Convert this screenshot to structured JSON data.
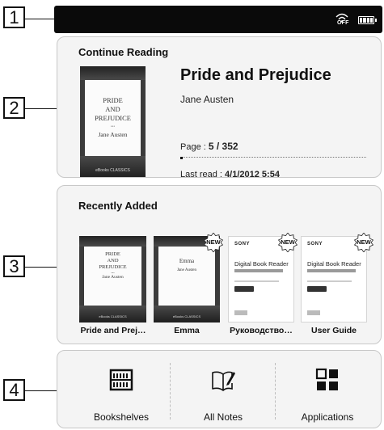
{
  "callouts": [
    "1",
    "2",
    "3",
    "4"
  ],
  "status_bar": {
    "wifi_label": "OFF",
    "wifi_icon": "wifi-off-icon",
    "battery_icon": "battery-icon"
  },
  "continue_reading": {
    "title": "Continue Reading",
    "cover": {
      "line1": "PRIDE",
      "line2": "AND",
      "line3": "PREJUDICE",
      "ornament": "•••",
      "author": "Jane Austen",
      "publisher": "eBooks CLASSICS"
    },
    "book_title": "Pride and Prejudice",
    "author": "Jane Austen",
    "page_label": "Page : ",
    "page_value": "5 / 352",
    "last_read_label": "Last read : ",
    "last_read_value": "4/1/2012 5:54"
  },
  "recently_added": {
    "title": "Recently Added",
    "new_badge": "NEW",
    "items": [
      {
        "label": "Pride and Prej…",
        "cover": {
          "line1": "PRIDE",
          "line2": "AND",
          "line3": "PREJUDICE",
          "ornament": "•••",
          "author": "Jane Austen",
          "publisher": "eBooks CLASSICS"
        }
      },
      {
        "label": "Emma",
        "cover": {
          "line1": "Emma",
          "author": "Jane Austen",
          "publisher": "eBooks CLASSICS"
        }
      },
      {
        "label": "Руководство…",
        "doc": {
          "brand": "SONY",
          "title": "Digital Book Reader"
        }
      },
      {
        "label": "User Guide",
        "doc": {
          "brand": "SONY",
          "title": "Digital Book Reader"
        }
      }
    ]
  },
  "bottom_nav": [
    {
      "label": "Bookshelves",
      "icon": "bookshelves-icon"
    },
    {
      "label": "All Notes",
      "icon": "notes-icon"
    },
    {
      "label": "Applications",
      "icon": "applications-icon"
    }
  ]
}
